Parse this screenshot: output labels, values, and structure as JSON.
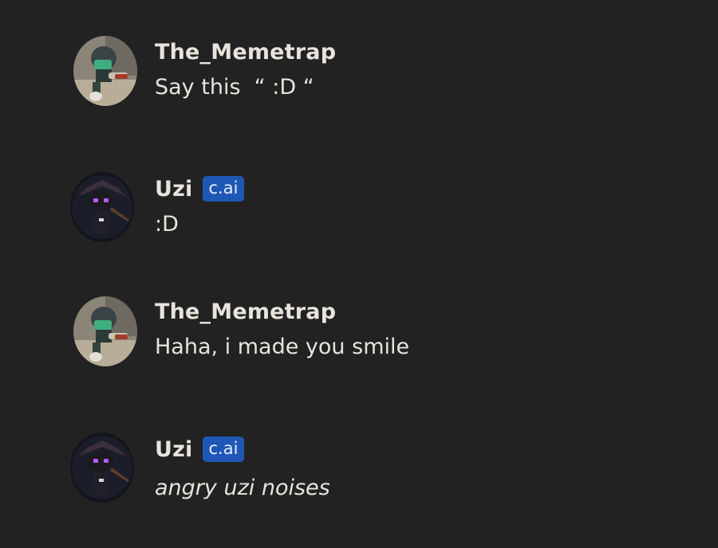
{
  "messages": [
    {
      "username": "The_Memetrap",
      "badge": "",
      "text": "Say this  “ :D “",
      "italic": false,
      "avatar_icon": "user-avatar-icon"
    },
    {
      "username": "Uzi",
      "badge": "c.ai",
      "text": ":D",
      "italic": false,
      "avatar_icon": "bot-avatar-icon"
    },
    {
      "username": "The_Memetrap",
      "badge": "",
      "text": "Haha, i made you smile",
      "italic": false,
      "avatar_icon": "user-avatar-icon"
    },
    {
      "username": "Uzi",
      "badge": "c.ai",
      "text": "angry uzi noises",
      "italic": true,
      "avatar_icon": "bot-avatar-icon"
    }
  ],
  "colors": {
    "background": "#222222",
    "text": "#e8e4dc",
    "badge_bg": "#1f57b5",
    "bot_eye": "#b55cff"
  }
}
